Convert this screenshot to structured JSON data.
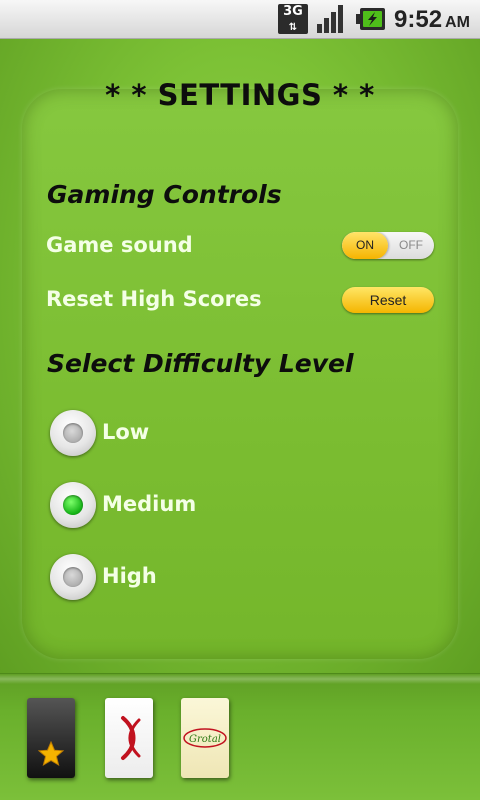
{
  "status_bar": {
    "network_label": "3G",
    "time": "9:52",
    "ampm": "AM",
    "icons": [
      "3g-data-icon",
      "signal-icon",
      "battery-charging-icon"
    ]
  },
  "settings": {
    "title": "* * SETTINGS * *",
    "gaming_controls": {
      "heading": "Gaming Controls",
      "game_sound_label": "Game sound",
      "toggle_on": "ON",
      "toggle_off": "OFF",
      "game_sound_state": "ON",
      "reset_scores_label": "Reset High Scores",
      "reset_button": "Reset"
    },
    "difficulty": {
      "heading": "Select Difficulty Level",
      "options": [
        {
          "label": "Low",
          "selected": false
        },
        {
          "label": "Medium",
          "selected": true
        },
        {
          "label": "High",
          "selected": false
        }
      ]
    }
  },
  "dock": {
    "apps": [
      {
        "icon": "favorites-star-icon"
      },
      {
        "icon": "red-curves-logo-icon"
      },
      {
        "icon": "grotal-logo-icon",
        "logo_text": "Grotal"
      }
    ]
  },
  "colors": {
    "background_green": "#7cc135",
    "accent_yellow": "#f6b400",
    "selected_radio": "#18b619",
    "label_text": "#f4ffe6"
  }
}
